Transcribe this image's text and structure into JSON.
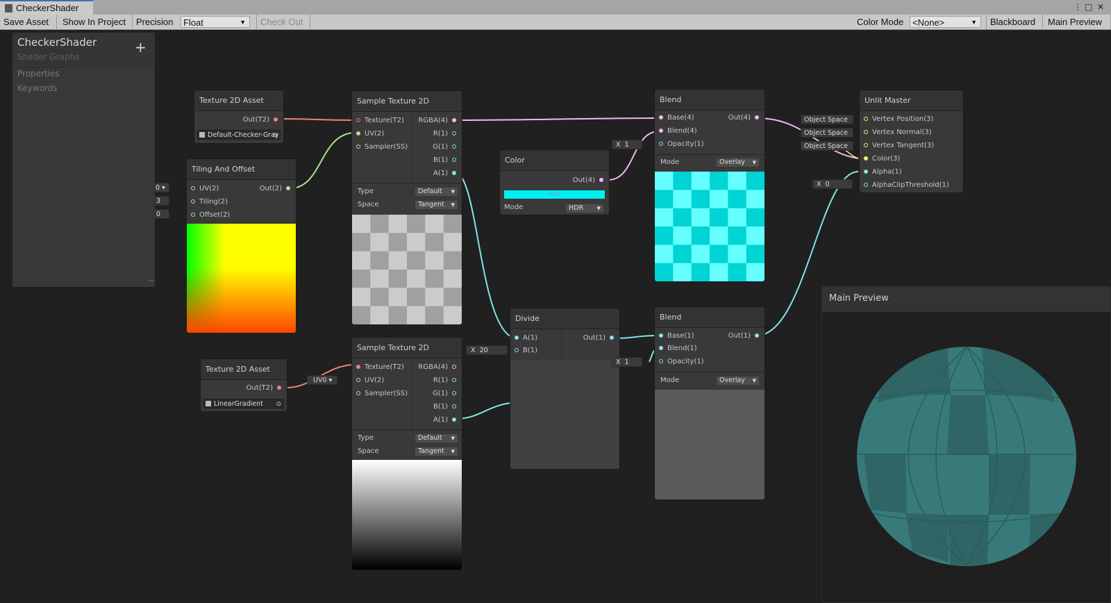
{
  "window": {
    "tab_title": "CheckerShader",
    "buttons": [
      "⋮",
      "□",
      "✕"
    ]
  },
  "toolbar": {
    "save_asset": "Save Asset",
    "show_in_project": "Show In Project",
    "precision_label": "Precision",
    "precision_value": "Float",
    "check_out": "Check Out",
    "color_mode_label": "Color Mode",
    "color_mode_value": "<None>",
    "blackboard": "Blackboard",
    "main_preview": "Main Preview"
  },
  "blackboard": {
    "title": "CheckerShader",
    "subtitle": "Shader Graphs",
    "add_icon": "+",
    "sections": [
      "Properties",
      "Keywords"
    ]
  },
  "nodes": {
    "tex_asset_1": {
      "title": "Texture 2D Asset",
      "out": "Out(T2)",
      "asset": "Default-Checker-Gray"
    },
    "tiling": {
      "title": "Tiling And Offset",
      "inputs": [
        "UV(2)",
        "Tiling(2)",
        "Offset(2)"
      ],
      "out": "Out(2)",
      "uv_chip": "0",
      "tiling_val": "3",
      "offset_val": "0"
    },
    "sample_1": {
      "title": "Sample Texture 2D",
      "inputs": [
        "Texture(T2)",
        "UV(2)",
        "Sampler(SS)"
      ],
      "outputs": [
        "RGBA(4)",
        "R(1)",
        "G(1)",
        "B(1)",
        "A(1)"
      ],
      "type_label": "Type",
      "type_value": "Default",
      "space_label": "Space",
      "space_value": "Tangent"
    },
    "color": {
      "title": "Color",
      "out": "Out(4)",
      "swatch_text": "HDR",
      "mode_label": "Mode",
      "mode_value": "HDR",
      "swatch_color": "#00f0f0"
    },
    "blend_1": {
      "title": "Blend",
      "inputs": [
        "Base(4)",
        "Blend(4)",
        "Opacity(1)"
      ],
      "out": "Out(4)",
      "opacity_x": "X",
      "opacity_val": "1",
      "mode_label": "Mode",
      "mode_value": "Overlay"
    },
    "unlit": {
      "title": "Unlit Master",
      "inputs": [
        "Vertex Position(3)",
        "Vertex Normal(3)",
        "Vertex Tangent(3)",
        "Color(3)",
        "Alpha(1)",
        "AlphaClipThreshold(1)"
      ],
      "space_chips": [
        "Object Space",
        "Object Space",
        "Object Space"
      ],
      "alpha_x": "X",
      "alpha_val": "0"
    },
    "tex_asset_2": {
      "title": "Texture 2D Asset",
      "out": "Out(T2)",
      "asset": "LinearGradient"
    },
    "sample_2": {
      "title": "Sample Texture 2D",
      "inputs": [
        "Texture(T2)",
        "UV(2)",
        "Sampler(SS)"
      ],
      "outputs": [
        "RGBA(4)",
        "R(1)",
        "G(1)",
        "B(1)",
        "A(1)"
      ],
      "uv_chip": "UV0",
      "type_label": "Type",
      "type_value": "Default",
      "space_label": "Space",
      "space_value": "Tangent"
    },
    "divide": {
      "title": "Divide",
      "inputs": [
        "A(1)",
        "B(1)"
      ],
      "out": "Out(1)",
      "b_x": "X",
      "b_val": "20"
    },
    "blend_2": {
      "title": "Blend",
      "inputs": [
        "Base(1)",
        "Blend(1)",
        "Opacity(1)"
      ],
      "out": "Out(1)",
      "opacity_x": "X",
      "opacity_val": "1",
      "mode_label": "Mode",
      "mode_value": "Overlay"
    }
  },
  "main_preview": {
    "title": "Main Preview"
  },
  "colors": {
    "canvas": "#202020",
    "node_bg": "#393939",
    "edge_tex": "#f08080",
    "edge_uv": "#a8e888",
    "edge_v4": "#f4b6f0",
    "edge_v1": "#84e4e8",
    "accent_tab": "#3a72b0"
  }
}
